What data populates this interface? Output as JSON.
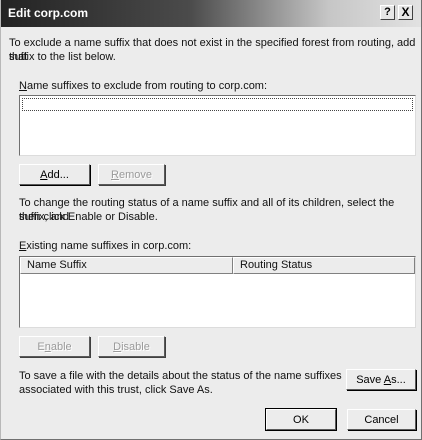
{
  "window": {
    "title": "Edit corp.com",
    "help_button": "?",
    "close_button": "X"
  },
  "intro": {
    "line1": "To exclude a name suffix that does not exist in the specified forest from routing, add that",
    "line2": "suffix to the list below."
  },
  "exclude_section": {
    "label": "Name suffixes to exclude from routing to corp.com:",
    "label_accel": "N",
    "label_rest": "ame suffixes to exclude from routing to corp.com:",
    "items": [],
    "add_button": {
      "accel": "A",
      "rest": "dd..."
    },
    "remove_button": {
      "accel": "R",
      "rest": "emove"
    }
  },
  "routing_info": {
    "line1": "To change the routing status of a name suffix and all of its children, select the suffix, and",
    "line2": "then click Enable or Disable."
  },
  "existing_section": {
    "label_accel": "E",
    "label_rest": "xisting name suffixes in corp.com:",
    "columns": [
      "Name Suffix",
      "Routing Status"
    ],
    "rows": [],
    "enable_button": {
      "pre": "E",
      "accel": "n",
      "rest": "able"
    },
    "disable_button": {
      "accel": "D",
      "rest": "isable"
    }
  },
  "save_info": {
    "line1": "To save a file with the details about the status of the name suffixes",
    "line2": "associated with this trust, click Save As.",
    "save_as_button": {
      "pre": "Save ",
      "accel": "A",
      "rest": "s..."
    }
  },
  "footer": {
    "ok_label": "OK",
    "cancel_label": "Cancel"
  }
}
